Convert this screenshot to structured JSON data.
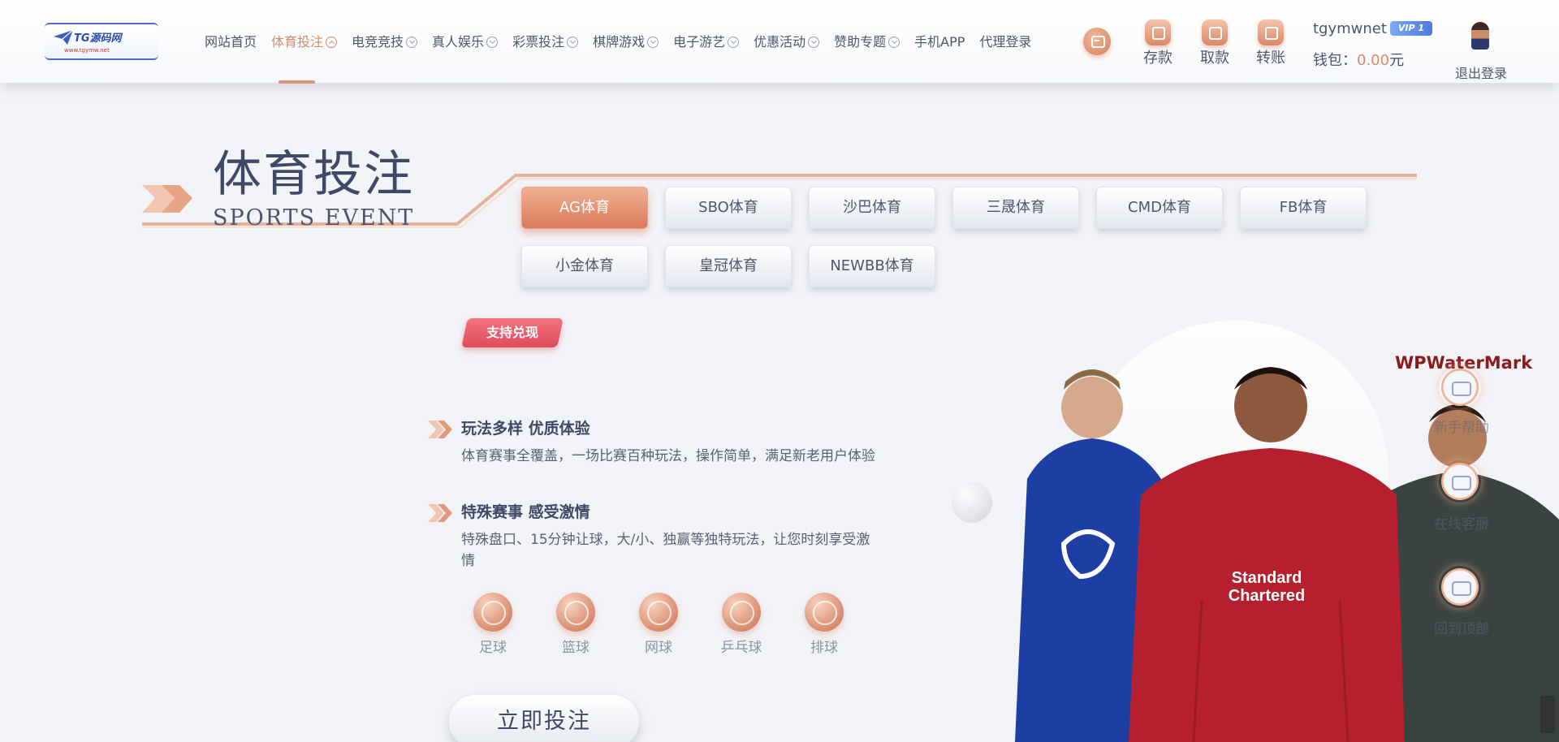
{
  "logo": {
    "text": "TG源码网",
    "url": "www.tgymw.net"
  },
  "nav": {
    "items": [
      {
        "label": "网站首页",
        "dropdown": false
      },
      {
        "label": "体育投注",
        "dropdown": true,
        "active": true
      },
      {
        "label": "电竞竞技",
        "dropdown": true
      },
      {
        "label": "真人娱乐",
        "dropdown": true
      },
      {
        "label": "彩票投注",
        "dropdown": true
      },
      {
        "label": "棋牌游戏",
        "dropdown": true
      },
      {
        "label": "电子游艺",
        "dropdown": true
      },
      {
        "label": "优惠活动",
        "dropdown": true
      },
      {
        "label": "赞助专题",
        "dropdown": true
      },
      {
        "label": "手机APP",
        "dropdown": false
      },
      {
        "label": "代理登录",
        "dropdown": false
      }
    ]
  },
  "header_actions": {
    "deposit": "存款",
    "withdraw": "取款",
    "transfer": "转账"
  },
  "user": {
    "name": "tgymwnet",
    "vip": "VIP 1",
    "wallet_label": "钱包：",
    "wallet_amount": "0.00",
    "wallet_unit": "元",
    "logout": "退出登录"
  },
  "section": {
    "title_cn": "体育投注",
    "title_en": "SPORTS EVENT"
  },
  "tabs": [
    {
      "label": "AG体育",
      "active": true
    },
    {
      "label": "SBO体育"
    },
    {
      "label": "沙巴体育"
    },
    {
      "label": "三晟体育"
    },
    {
      "label": "CMD体育"
    },
    {
      "label": "FB体育"
    },
    {
      "label": "小金体育"
    },
    {
      "label": "皇冠体育"
    },
    {
      "label": "NEWBB体育"
    }
  ],
  "badge": "支持兑现",
  "features": [
    {
      "title": "玩法多样 优质体验",
      "desc": "体育赛事全覆盖，一场比赛百种玩法，操作简单，满足新老用户体验"
    },
    {
      "title": "特殊赛事 感受激情",
      "desc": "特殊盘口、15分钟让球，大/小、独赢等独特玩法，让您时刻享受激情"
    }
  ],
  "sports": [
    {
      "label": "足球",
      "icon": "soccer-ball-icon"
    },
    {
      "label": "篮球",
      "icon": "basketball-icon"
    },
    {
      "label": "网球",
      "icon": "tennis-ball-icon"
    },
    {
      "label": "乒乓球",
      "icon": "ping-pong-icon"
    },
    {
      "label": "排球",
      "icon": "volleyball-icon"
    }
  ],
  "cta": "立即投注",
  "float_widget": {
    "watermark": "WPWaterMark",
    "help": "新手帮助",
    "service": "在线客服",
    "top": "回到顶部"
  },
  "colors": {
    "accent": "#d48c6c",
    "badge": "#e04a5c",
    "vip": "#4b7bdc"
  }
}
